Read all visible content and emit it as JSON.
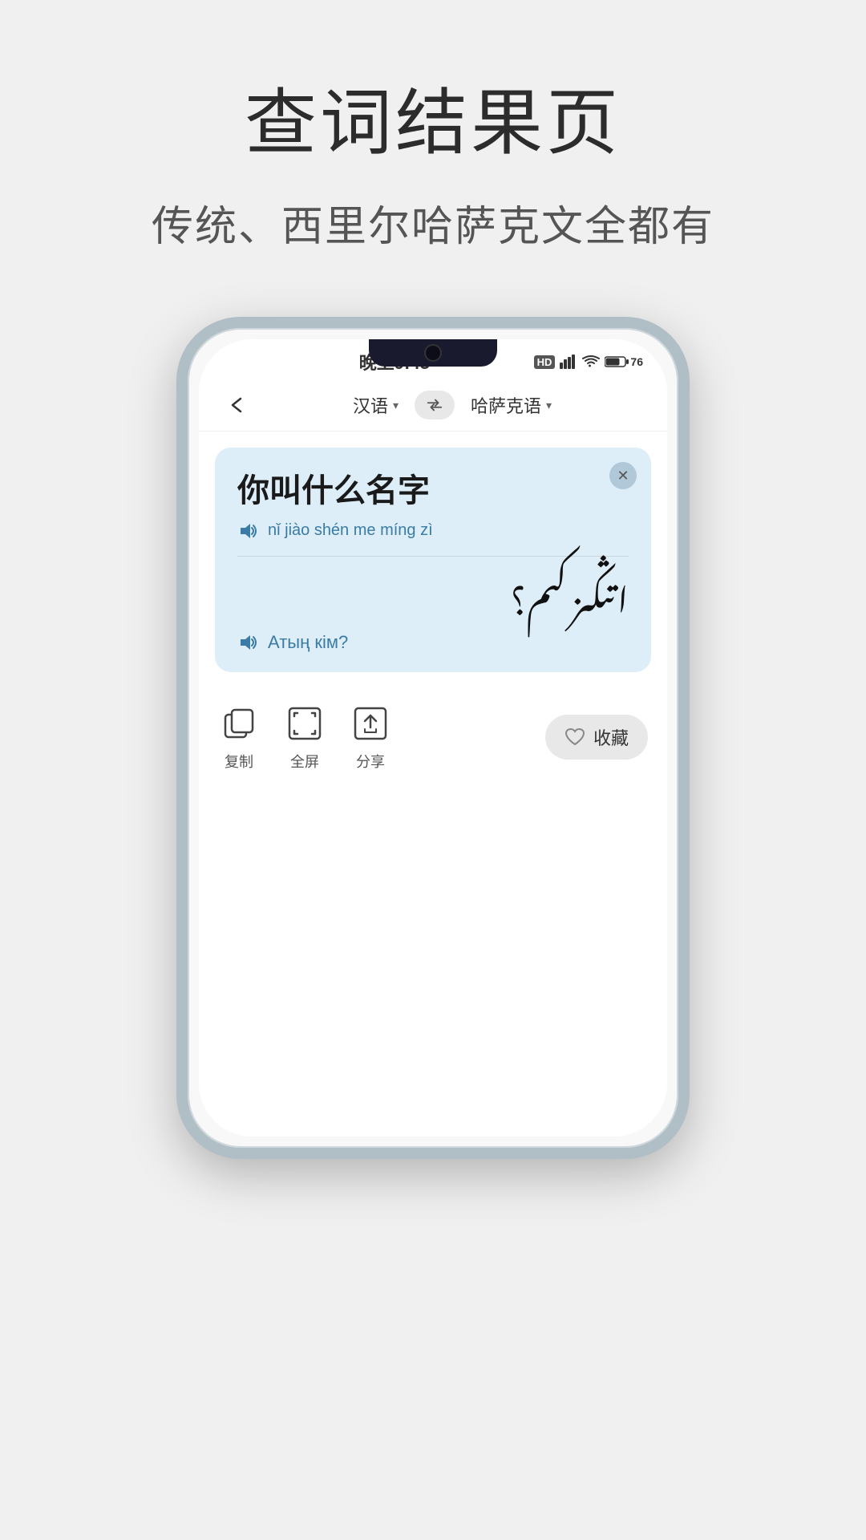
{
  "page": {
    "title": "查词结果页",
    "subtitle": "传统、西里尔哈萨克文全都有"
  },
  "statusBar": {
    "time": "晚上9:43",
    "battery": "76",
    "hd1": "HD",
    "hd2": "HD"
  },
  "nav": {
    "sourceLang": "汉语",
    "targetLang": "哈萨克语"
  },
  "card": {
    "sourceText": "你叫什么名字",
    "phonetic": "nǐ jiào shén me míng zì",
    "arabicText": "اتىڭىز كىم؟",
    "latinText": "Атың кім?"
  },
  "actions": {
    "copy": "复制",
    "fullscreen": "全屏",
    "share": "分享",
    "favorite": "收藏"
  }
}
